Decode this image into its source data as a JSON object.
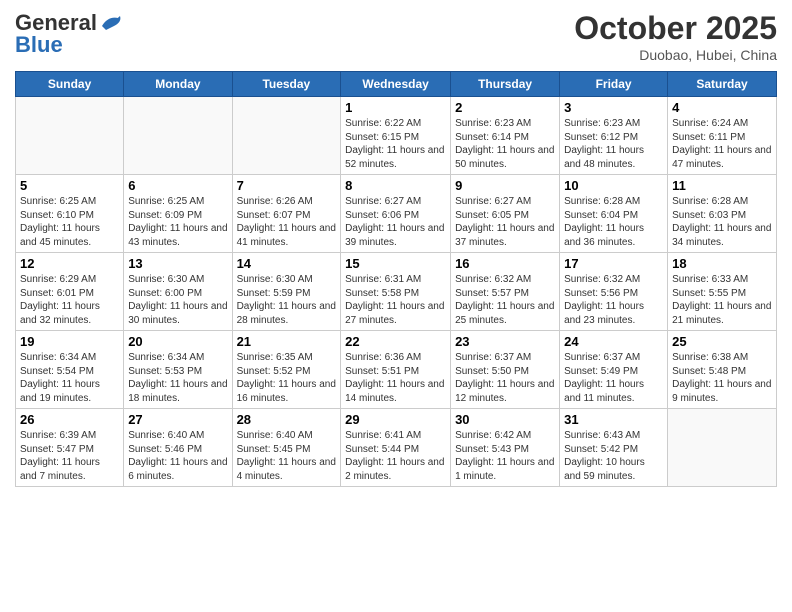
{
  "header": {
    "logo_line1": "General",
    "logo_line2": "Blue",
    "month": "October 2025",
    "location": "Duobao, Hubei, China"
  },
  "days_of_week": [
    "Sunday",
    "Monday",
    "Tuesday",
    "Wednesday",
    "Thursday",
    "Friday",
    "Saturday"
  ],
  "weeks": [
    [
      {
        "date": "",
        "text": ""
      },
      {
        "date": "",
        "text": ""
      },
      {
        "date": "",
        "text": ""
      },
      {
        "date": "1",
        "text": "Sunrise: 6:22 AM\nSunset: 6:15 PM\nDaylight: 11 hours and 52 minutes."
      },
      {
        "date": "2",
        "text": "Sunrise: 6:23 AM\nSunset: 6:14 PM\nDaylight: 11 hours and 50 minutes."
      },
      {
        "date": "3",
        "text": "Sunrise: 6:23 AM\nSunset: 6:12 PM\nDaylight: 11 hours and 48 minutes."
      },
      {
        "date": "4",
        "text": "Sunrise: 6:24 AM\nSunset: 6:11 PM\nDaylight: 11 hours and 47 minutes."
      }
    ],
    [
      {
        "date": "5",
        "text": "Sunrise: 6:25 AM\nSunset: 6:10 PM\nDaylight: 11 hours and 45 minutes."
      },
      {
        "date": "6",
        "text": "Sunrise: 6:25 AM\nSunset: 6:09 PM\nDaylight: 11 hours and 43 minutes."
      },
      {
        "date": "7",
        "text": "Sunrise: 6:26 AM\nSunset: 6:07 PM\nDaylight: 11 hours and 41 minutes."
      },
      {
        "date": "8",
        "text": "Sunrise: 6:27 AM\nSunset: 6:06 PM\nDaylight: 11 hours and 39 minutes."
      },
      {
        "date": "9",
        "text": "Sunrise: 6:27 AM\nSunset: 6:05 PM\nDaylight: 11 hours and 37 minutes."
      },
      {
        "date": "10",
        "text": "Sunrise: 6:28 AM\nSunset: 6:04 PM\nDaylight: 11 hours and 36 minutes."
      },
      {
        "date": "11",
        "text": "Sunrise: 6:28 AM\nSunset: 6:03 PM\nDaylight: 11 hours and 34 minutes."
      }
    ],
    [
      {
        "date": "12",
        "text": "Sunrise: 6:29 AM\nSunset: 6:01 PM\nDaylight: 11 hours and 32 minutes."
      },
      {
        "date": "13",
        "text": "Sunrise: 6:30 AM\nSunset: 6:00 PM\nDaylight: 11 hours and 30 minutes."
      },
      {
        "date": "14",
        "text": "Sunrise: 6:30 AM\nSunset: 5:59 PM\nDaylight: 11 hours and 28 minutes."
      },
      {
        "date": "15",
        "text": "Sunrise: 6:31 AM\nSunset: 5:58 PM\nDaylight: 11 hours and 27 minutes."
      },
      {
        "date": "16",
        "text": "Sunrise: 6:32 AM\nSunset: 5:57 PM\nDaylight: 11 hours and 25 minutes."
      },
      {
        "date": "17",
        "text": "Sunrise: 6:32 AM\nSunset: 5:56 PM\nDaylight: 11 hours and 23 minutes."
      },
      {
        "date": "18",
        "text": "Sunrise: 6:33 AM\nSunset: 5:55 PM\nDaylight: 11 hours and 21 minutes."
      }
    ],
    [
      {
        "date": "19",
        "text": "Sunrise: 6:34 AM\nSunset: 5:54 PM\nDaylight: 11 hours and 19 minutes."
      },
      {
        "date": "20",
        "text": "Sunrise: 6:34 AM\nSunset: 5:53 PM\nDaylight: 11 hours and 18 minutes."
      },
      {
        "date": "21",
        "text": "Sunrise: 6:35 AM\nSunset: 5:52 PM\nDaylight: 11 hours and 16 minutes."
      },
      {
        "date": "22",
        "text": "Sunrise: 6:36 AM\nSunset: 5:51 PM\nDaylight: 11 hours and 14 minutes."
      },
      {
        "date": "23",
        "text": "Sunrise: 6:37 AM\nSunset: 5:50 PM\nDaylight: 11 hours and 12 minutes."
      },
      {
        "date": "24",
        "text": "Sunrise: 6:37 AM\nSunset: 5:49 PM\nDaylight: 11 hours and 11 minutes."
      },
      {
        "date": "25",
        "text": "Sunrise: 6:38 AM\nSunset: 5:48 PM\nDaylight: 11 hours and 9 minutes."
      }
    ],
    [
      {
        "date": "26",
        "text": "Sunrise: 6:39 AM\nSunset: 5:47 PM\nDaylight: 11 hours and 7 minutes."
      },
      {
        "date": "27",
        "text": "Sunrise: 6:40 AM\nSunset: 5:46 PM\nDaylight: 11 hours and 6 minutes."
      },
      {
        "date": "28",
        "text": "Sunrise: 6:40 AM\nSunset: 5:45 PM\nDaylight: 11 hours and 4 minutes."
      },
      {
        "date": "29",
        "text": "Sunrise: 6:41 AM\nSunset: 5:44 PM\nDaylight: 11 hours and 2 minutes."
      },
      {
        "date": "30",
        "text": "Sunrise: 6:42 AM\nSunset: 5:43 PM\nDaylight: 11 hours and 1 minute."
      },
      {
        "date": "31",
        "text": "Sunrise: 6:43 AM\nSunset: 5:42 PM\nDaylight: 10 hours and 59 minutes."
      },
      {
        "date": "",
        "text": ""
      }
    ]
  ]
}
